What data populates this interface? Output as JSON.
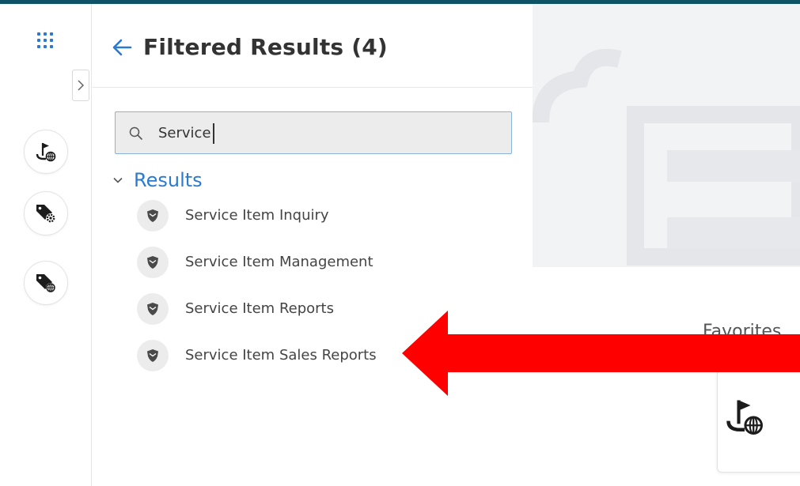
{
  "panel": {
    "title": "Filtered Results (4)"
  },
  "search": {
    "value": "Service",
    "placeholder": ""
  },
  "results": {
    "header": "Results",
    "items": [
      {
        "label": "Service Item Inquiry"
      },
      {
        "label": "Service Item Management"
      },
      {
        "label": "Service Item Reports"
      },
      {
        "label": "Service Item Sales Reports"
      }
    ]
  },
  "favorites": {
    "label": "Favorites"
  },
  "colors": {
    "accent_blue": "#2a7ad1",
    "top_line": "#0f5466",
    "icon_dark": "#1c1c1c",
    "annotation_arrow": "#ff0000",
    "app_grid": "#2a7ad1"
  },
  "icons": {
    "app_grid": "app-grid-icon",
    "rail_toggle": "chevron-right-icon",
    "rail_buttons": [
      "flag-globe-icon",
      "tag-gear-icon",
      "tag-globe-icon"
    ],
    "back": "arrow-left-icon",
    "search": "search-icon",
    "results_toggle": "chevron-down-icon",
    "result_item": "shield-icon"
  }
}
